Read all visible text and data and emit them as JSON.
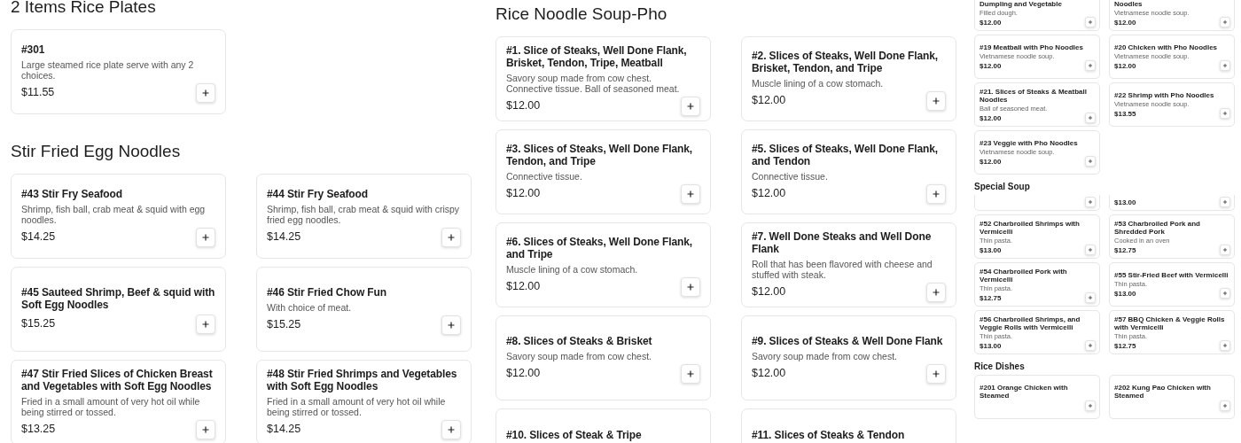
{
  "panels": [
    {
      "kind": "large",
      "sections": [
        {
          "title": "2 Items Rice Plates",
          "items": [
            {
              "name": "#301",
              "desc": "Large steamed rice plate serve with any 2 choices.",
              "price": "$11.55"
            }
          ]
        },
        {
          "title": "Stir Fried Egg Noodles",
          "items": [
            {
              "name": "#43 Stir Fry Seafood",
              "desc": "Shrimp, fish ball, crab meat & squid with egg noodles.",
              "price": "$14.25"
            },
            {
              "name": "#44 Stir Fry Seafood",
              "desc": "Shrimp, fish ball, crab meat & squid with crispy fried egg noodles.",
              "price": "$14.25"
            },
            {
              "name": "#45 Sauteed Shrimp, Beef & squid with Soft Egg Noodles",
              "price": "$15.25"
            },
            {
              "name": "#46 Stir Fried Chow Fun",
              "desc": "With choice of meat.",
              "price": "$15.25"
            },
            {
              "name": "#47 Stir Fried Slices of Chicken Breast and Vegetables with Soft Egg Noodles",
              "desc": "Fried in a small amount of very hot oil while being stirred or tossed.",
              "price": "$13.25"
            },
            {
              "name": "#48 Stir Fried Shrimps and Vegetables with Soft Egg Noodles",
              "desc": "Fried in a small amount of very hot oil while being stirred or tossed.",
              "price": "$14.25"
            }
          ]
        }
      ]
    },
    {
      "kind": "large",
      "sections": [
        {
          "title": "Rice Noodle Soup-Pho",
          "items": [
            {
              "name": "#1. Slice of Steaks, Well Done Flank, Brisket, Tendon, Tripe, Meatball",
              "desc": "Savory soup made from cow chest. Connective tissue. Ball of seasoned meat.",
              "price": "$12.00"
            },
            {
              "name": "#2. Slices of Steaks, Well Done Flank, Brisket, Tendon, and Tripe",
              "desc": "Muscle lining of a cow stomach.",
              "price": "$12.00"
            },
            {
              "name": "#3. Slices of Steaks, Well Done Flank, Tendon, and Tripe",
              "desc": "Connective tissue.",
              "price": "$12.00"
            },
            {
              "name": "#5. Slices of Steaks, Well Done Flank, and Tendon",
              "desc": "Connective tissue.",
              "price": "$12.00"
            },
            {
              "name": "#6. Slices of Steaks, Well Done Flank, and Tripe",
              "desc": "Muscle lining of a cow stomach.",
              "price": "$12.00"
            },
            {
              "name": "#7. Well Done Steaks and Well Done Flank",
              "desc": "Roll that has been flavored with cheese and stuffed with steak.",
              "price": "$12.00"
            },
            {
              "name": "#8. Slices of Steaks & Brisket",
              "desc": "Savory soup made from cow chest.",
              "price": "$12.00"
            },
            {
              "name": "#9. Slices of Steaks & Well Done Flank",
              "desc": "Savory soup made from cow chest.",
              "price": "$12.00"
            },
            {
              "name": "#10. Slices of Steak & Tripe"
            },
            {
              "name": "#11. Slices of Steaks & Tendon"
            }
          ]
        }
      ]
    },
    {
      "kind": "small",
      "sections": [
        {
          "items": [
            {
              "kind": "cut",
              "name": "Dumpling and Vegetable",
              "desc": "Filled dough.",
              "price": "$12.00"
            },
            {
              "kind": "cut",
              "name": "Noodles",
              "desc": "Vietnamese noodle soup.",
              "price": "$12.00"
            },
            {
              "kind": "card",
              "name": "#19 Meatball with Pho Noodles",
              "desc": "Vietnamese noodle soup.",
              "price": "$12.00"
            },
            {
              "kind": "card",
              "name": "#20 Chicken with Pho Noodles",
              "desc": "Vietnamese noodle soup.",
              "price": "$12.00"
            },
            {
              "kind": "card",
              "name": "#21. Slices of Steaks & Meatball Noodles",
              "desc": "Ball of seasoned meat.",
              "price": "$12.00"
            },
            {
              "kind": "card",
              "name": "#22 Shrimp with Pho Noodles",
              "desc": "Vietnamese noodle soup.",
              "price": "$13.55"
            },
            {
              "kind": "card",
              "name": "#23 Veggie with Pho Noodles",
              "desc": "Vietnamese noodle soup.",
              "price": "$12.00"
            }
          ]
        },
        {
          "title": "Special Soup",
          "items": [
            {
              "kind": "cut"
            },
            {
              "kind": "cut",
              "price": "$13.00"
            },
            {
              "kind": "card",
              "name": "#52 Charbroiled Shrimps with Vermicelli",
              "desc": "Thin pasta.",
              "price": "$13.00"
            },
            {
              "kind": "card",
              "name": "#53 Charbroiled Pork and Shredded Pork",
              "desc": "Cooked in an oven",
              "price": "$12.75"
            },
            {
              "kind": "card",
              "name": "#54 Charbroiled Pork with Vermicelli",
              "desc": "Thin pasta.",
              "price": "$12.75"
            },
            {
              "kind": "card",
              "name": "#55 Stir-Fried Beef with Vermicelli",
              "desc": "Thin pasta.",
              "price": "$13.00"
            },
            {
              "kind": "card",
              "name": "#56 Charbroiled Shrimps, and Veggie Rolls with Vermicelli",
              "desc": "Thin pasta.",
              "price": "$13.00"
            },
            {
              "kind": "card",
              "name": "#57 BBQ Chicken & Veggie Rolls with Vermicelli",
              "desc": "Thin pasta.",
              "price": "$12.75"
            }
          ]
        },
        {
          "title": "Rice Dishes",
          "items": [
            {
              "kind": "card",
              "name": "#201 Orange Chicken with Steamed"
            },
            {
              "kind": "card",
              "name": "#202 Kung Pao Chicken with Steamed"
            }
          ]
        }
      ]
    }
  ]
}
